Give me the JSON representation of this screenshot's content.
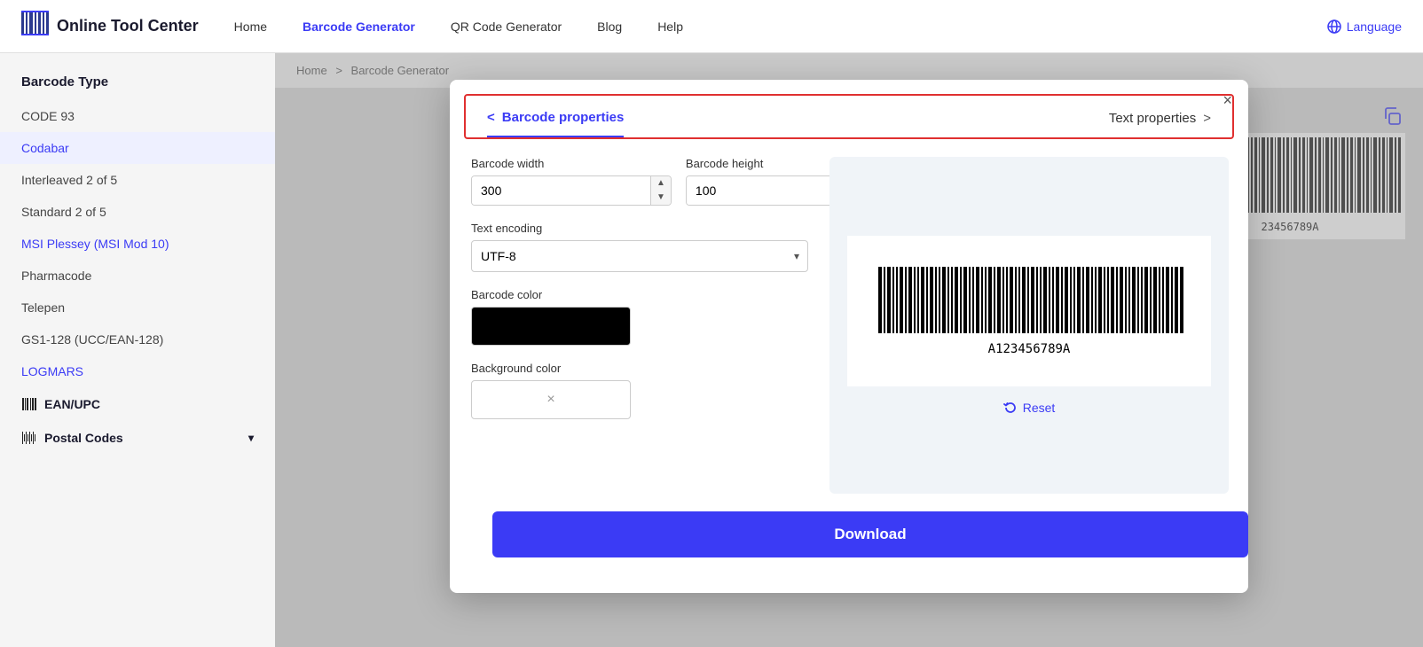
{
  "header": {
    "logo_icon": "|||",
    "logo_text": "Online Tool Center",
    "nav": [
      {
        "label": "Home",
        "active": false
      },
      {
        "label": "Barcode Generator",
        "active": true
      },
      {
        "label": "QR Code Generator",
        "active": false
      },
      {
        "label": "Blog",
        "active": false
      },
      {
        "label": "Help",
        "active": false
      }
    ],
    "language_label": "Language"
  },
  "breadcrumb": {
    "home": "Home",
    "sep": ">",
    "current": "Barcode Generator"
  },
  "sidebar": {
    "section_title": "Barcode Type",
    "items": [
      {
        "label": "CODE 93",
        "active": false,
        "blue": false
      },
      {
        "label": "Codabar",
        "active": true,
        "blue": true
      },
      {
        "label": "Interleaved 2 of 5",
        "active": false,
        "blue": false
      },
      {
        "label": "Standard 2 of 5",
        "active": false,
        "blue": false
      },
      {
        "label": "MSI Plessey (MSI Mod 10)",
        "active": false,
        "blue": true
      },
      {
        "label": "Pharmacode",
        "active": false,
        "blue": false
      },
      {
        "label": "Telepen",
        "active": false,
        "blue": false
      },
      {
        "label": "GS1-128 (UCC/EAN-128)",
        "active": false,
        "blue": false
      },
      {
        "label": "LOGMARS",
        "active": false,
        "blue": true
      }
    ],
    "section_ean": "EAN/UPC",
    "section_postal": "Postal Codes"
  },
  "modal": {
    "tab_barcode": "Barcode properties",
    "tab_text": "Text properties",
    "tab_barcode_arrow_left": "<",
    "tab_text_arrow_right": ">",
    "close_label": "×",
    "barcode_width_label": "Barcode width",
    "barcode_width_value": "300",
    "barcode_height_label": "Barcode height",
    "barcode_height_value": "100",
    "text_encoding_label": "Text encoding",
    "text_encoding_value": "UTF-8",
    "barcode_color_label": "Barcode color",
    "background_color_label": "Background color",
    "background_color_clear": "×",
    "reset_label": "Reset",
    "download_label": "Download",
    "barcode_preview_text": "A123456789A"
  }
}
